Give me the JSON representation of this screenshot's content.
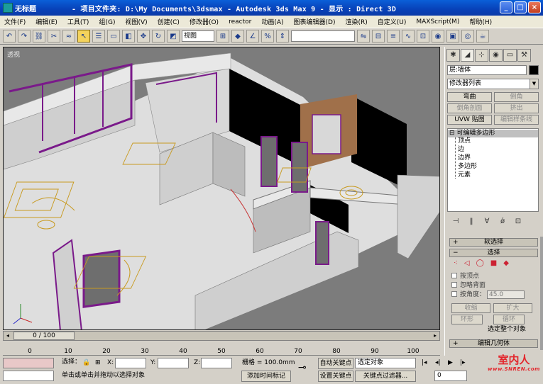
{
  "window": {
    "doc_title": "无标题",
    "title": "- 项目文件夹: D:\\My Documents\\3dsmax  - Autodesk 3ds Max 9  - 显示 : Direct 3D",
    "btn_min": "_",
    "btn_max": "□",
    "btn_close": "×"
  },
  "menu": [
    "文件(F)",
    "编辑(E)",
    "工具(T)",
    "组(G)",
    "视图(V)",
    "创建(C)",
    "修改器(O)",
    "reactor",
    "动画(A)",
    "图表编辑器(D)",
    "渲染(R)",
    "自定义(U)",
    "MAXScript(M)",
    "帮助(H)"
  ],
  "toolbar": {
    "view_select": "视图",
    "icons": [
      "undo-icon",
      "redo-icon",
      "link-icon",
      "unlink-icon",
      "bind-icon",
      "select-arrow-icon",
      "select-name-icon",
      "rect-select-icon",
      "window-cross-icon",
      "move-icon",
      "rotate-icon",
      "scale-icon",
      "pivot-icon",
      "snap-3d-icon",
      "angle-snap-icon",
      "percent-snap-icon",
      "spinner-snap-icon",
      "mirror-icon",
      "align-icon",
      "layer-icon",
      "curve-editor-icon",
      "schematic-icon",
      "material-editor-icon",
      "render-setup-icon",
      "quick-render-icon",
      "teapot-icon"
    ]
  },
  "viewport": {
    "label": "透视"
  },
  "timeline": {
    "frame_display": "0 / 100",
    "ticks": [
      0,
      10,
      20,
      30,
      40,
      50,
      60,
      70,
      80,
      90,
      100
    ]
  },
  "status": {
    "selection": "选择：",
    "x_label": "X:",
    "y_label": "Y:",
    "z_label": "Z:",
    "grid_label": "栅格 = 100.0mm",
    "auto_key": "自动关键点",
    "set_key": "设置关键点",
    "selected_object": "选定对象",
    "key_filter": "关键点过滤器...",
    "prompt": "单击或单击并拖动以选择对象",
    "add_time_tag": "添加时间标记",
    "frame_value": "0"
  },
  "command_panel": {
    "tabs": [
      "create-tab-icon",
      "modify-tab-icon",
      "hierarchy-tab-icon",
      "motion-tab-icon",
      "display-tab-icon",
      "utilities-tab-icon"
    ],
    "object_name": "层:墙体",
    "modifier_list": "修改器列表",
    "buttons": {
      "bend": "弯曲",
      "chamfer": "倒角",
      "chamfer_profile": "倒角剖面",
      "extrude": "挤出",
      "uvw_map": "UVW 贴图",
      "edit_spline": "编辑样条线"
    },
    "stack": {
      "root": "可编辑多边形",
      "items": [
        "顶点",
        "边",
        "边界",
        "多边形",
        "元素"
      ]
    },
    "rollouts": {
      "soft_select": "软选择",
      "selection": "选择",
      "edit_geometry": "编辑几何体"
    },
    "selection": {
      "by_vertex": "按顶点",
      "ignore_backfacing": "忽略背面",
      "by_angle": "按角度：",
      "angle_value": "45.0",
      "shrink": "收缩",
      "grow": "扩大",
      "ring": "环形",
      "loop": "循环",
      "whole_object": "选定整个对象"
    }
  },
  "watermark": {
    "main": "室内人",
    "sub": "www.SNREN.com"
  },
  "colors": {
    "title_bar": "#0a4fc8",
    "wall": "#dcdcdc",
    "window_frame": "#7a1a8a",
    "furniture_lines": "#c89a20",
    "black_panel": "#000000",
    "wood": "#a0704a"
  }
}
